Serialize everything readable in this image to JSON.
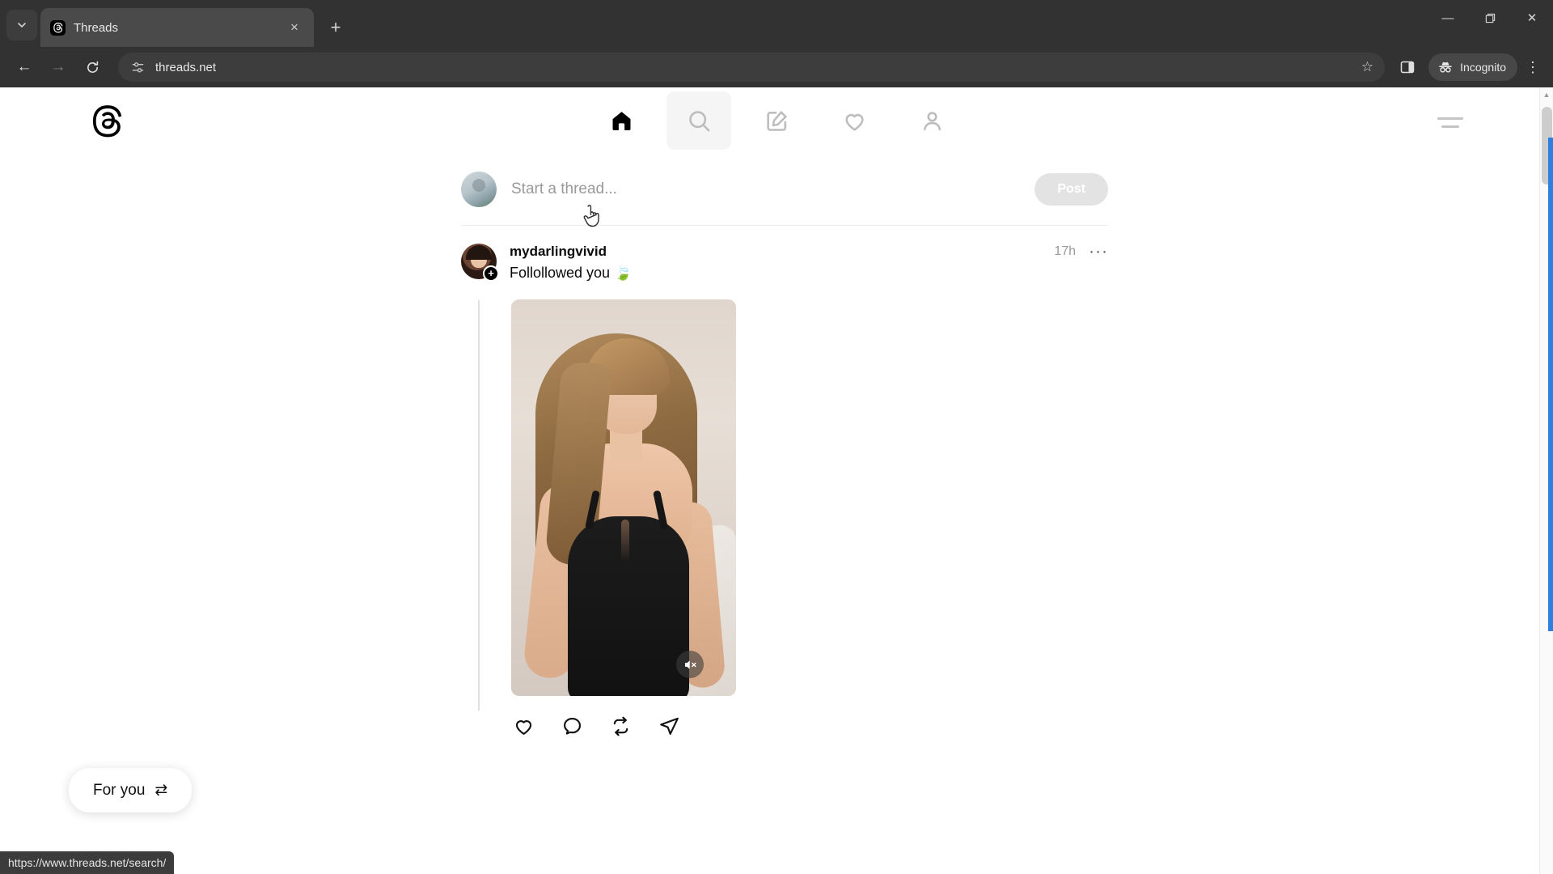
{
  "browser": {
    "tab": {
      "title": "Threads",
      "favicon": "threads-favicon",
      "close": "×"
    },
    "tab_search_icon": "▼",
    "new_tab_label": "+",
    "window": {
      "minimize": "—",
      "maximize": "❐",
      "close": "✕"
    },
    "toolbar": {
      "back": "←",
      "forward": "→",
      "reload": "↻",
      "site_info_icon": "tune-icon",
      "url": "threads.net",
      "bookmark_icon": "☆",
      "sidepanel_icon": "side-panel-icon",
      "incognito_label": "Incognito",
      "menu_icon": "⋮"
    },
    "status_bar_url": "https://www.threads.net/search/"
  },
  "threads": {
    "logo_alt": "threads-logo",
    "nav": [
      {
        "name": "home",
        "icon": "home-icon",
        "active": true
      },
      {
        "name": "search",
        "icon": "search-icon",
        "active": false,
        "hovered": true
      },
      {
        "name": "compose",
        "icon": "compose-icon",
        "active": false
      },
      {
        "name": "activity",
        "icon": "heart-icon",
        "active": false
      },
      {
        "name": "profile",
        "icon": "person-icon",
        "active": false
      }
    ],
    "menu_icon": "hamburger-icon",
    "composer": {
      "placeholder": "Start a thread...",
      "post_label": "Post",
      "avatar_alt": "current-user-avatar"
    },
    "post": {
      "username": "mydarlingvivid",
      "timestamp": "17h",
      "more_label": "···",
      "text": "Follollowed you 🍃",
      "avatar_badge": "+",
      "media_type": "video",
      "muted": true,
      "actions": [
        {
          "name": "like",
          "icon": "heart-icon"
        },
        {
          "name": "reply",
          "icon": "comment-icon"
        },
        {
          "name": "repost",
          "icon": "repost-icon"
        },
        {
          "name": "share",
          "icon": "share-icon"
        }
      ]
    },
    "feed_selector": {
      "label": "For you",
      "icon": "⇄"
    }
  },
  "colors": {
    "chrome_bg": "#323232",
    "accent_blue": "#2f7fe0",
    "text_primary": "#0a0a0a",
    "text_muted": "#999999",
    "post_button_bg": "#e3e3e3"
  }
}
